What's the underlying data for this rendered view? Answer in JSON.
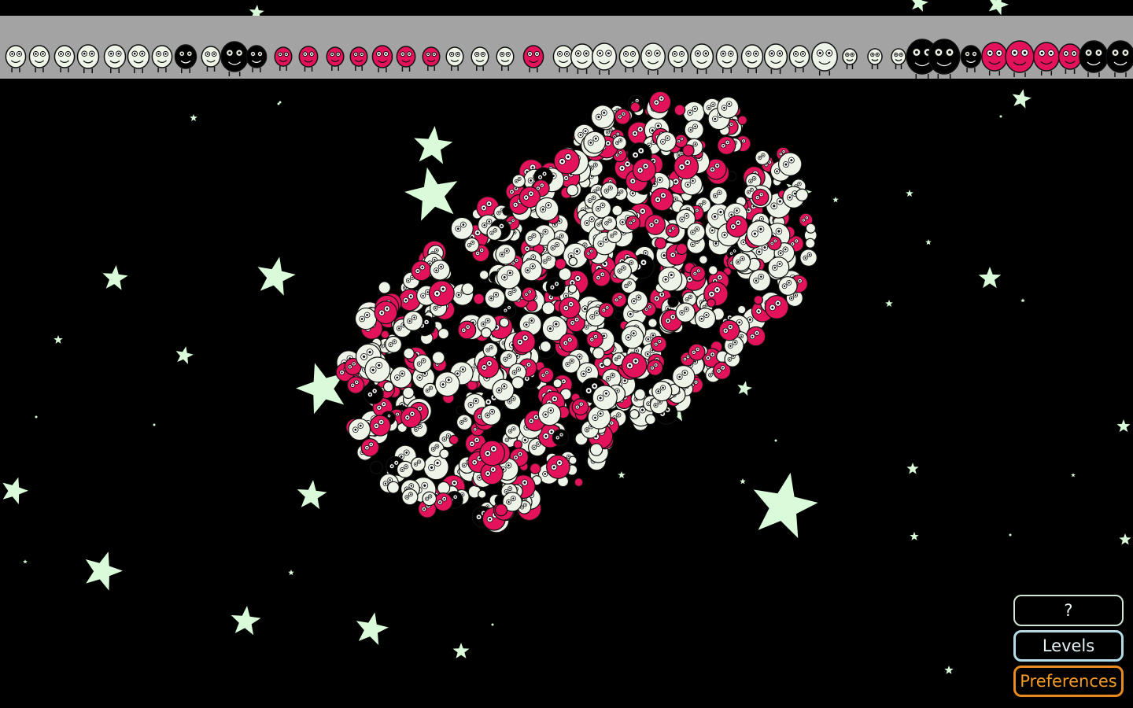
{
  "colors": {
    "background": "#000000",
    "star": "#d9fbd9",
    "strip": "#a3a3a3",
    "monster_white": "#eef5e8",
    "monster_pink": "#e3125b",
    "monster_black": "#000000",
    "button_help_border": "#cfe6d4",
    "button_levels_border": "#b4dce8",
    "button_prefs_border": "#e88a1e"
  },
  "buttons": {
    "help": "?",
    "levels": "Levels",
    "preferences": "Preferences"
  },
  "icons": {
    "strip_items": "monster-icon",
    "stars": "star-icon",
    "cluster": "monster-cluster-icon"
  }
}
